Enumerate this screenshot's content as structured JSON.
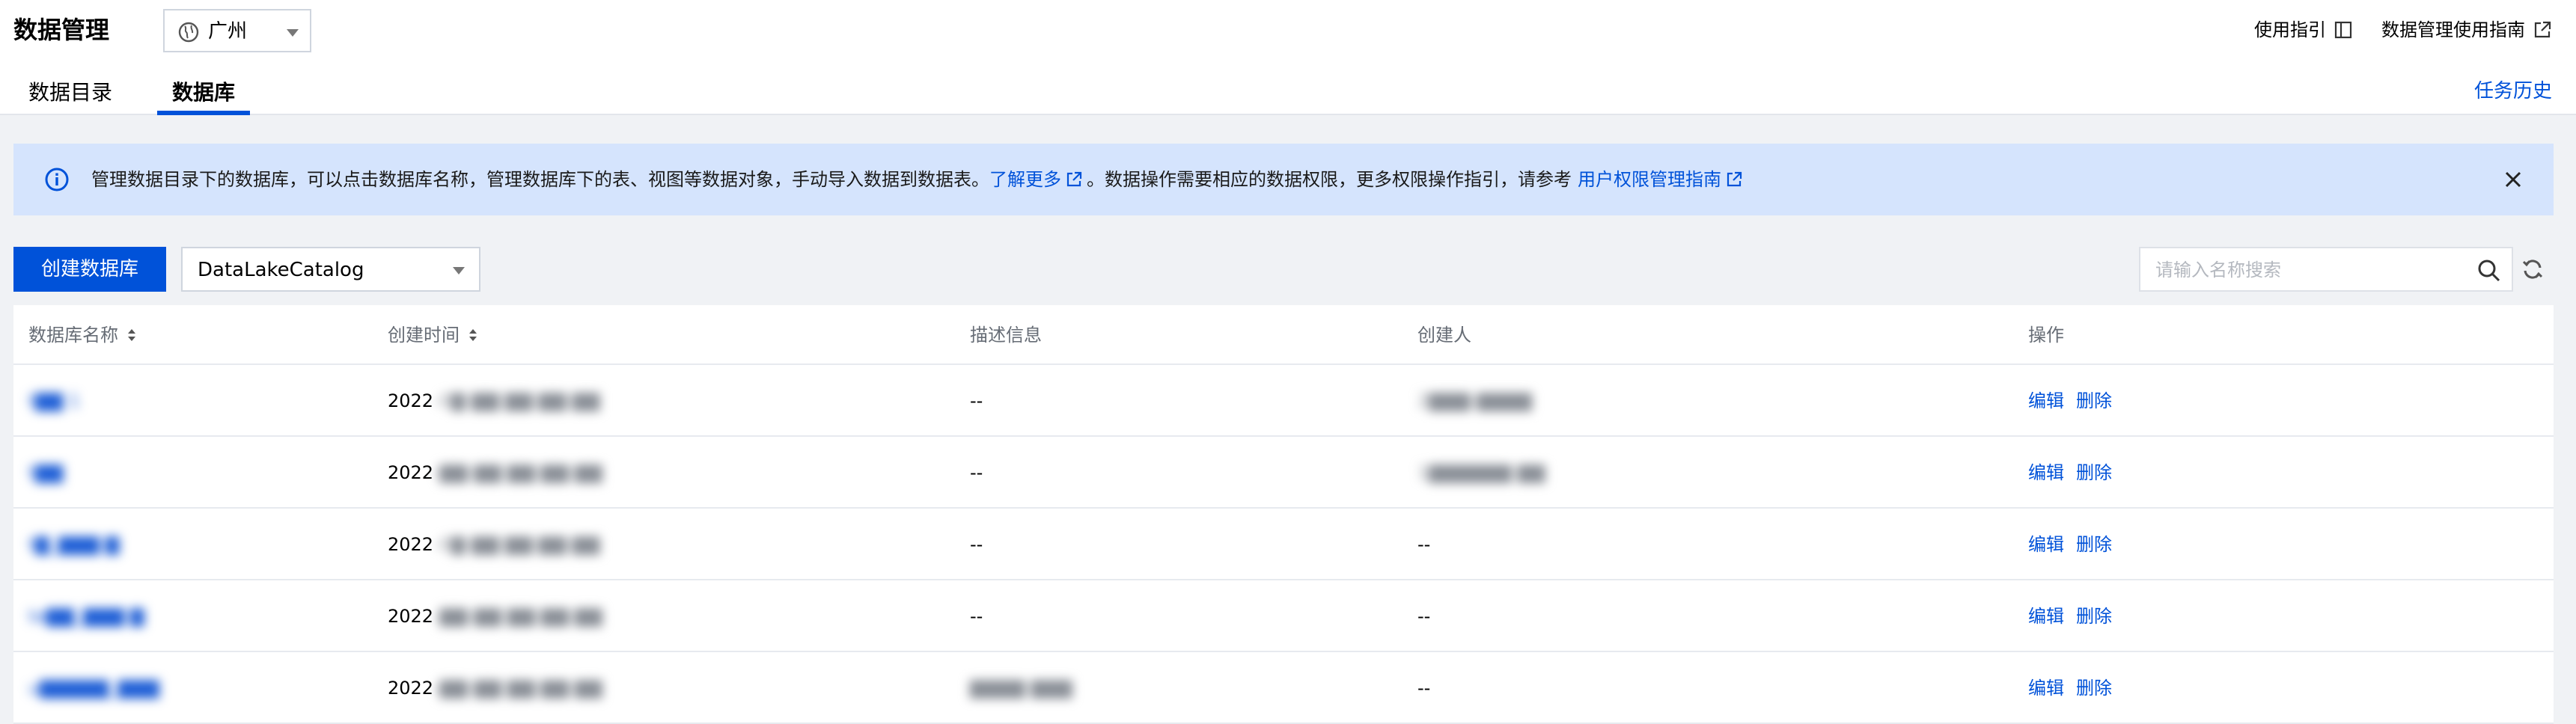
{
  "header": {
    "title": "数据管理",
    "region": "广州",
    "guide_link": "使用指引",
    "manual_link": "数据管理使用指南",
    "tabs": [
      "数据目录",
      "数据库"
    ],
    "active_tab": "数据库",
    "task_history": "任务历史"
  },
  "banner": {
    "text_part1": "管理数据目录下的数据库，可以点击数据库名称，管理数据库下的表、视图等数据对象，手动导入数据到数据表。",
    "learn_more": "了解更多",
    "text_part2": "。数据操作需要相应的数据权限，更多权限操作指引，请参考",
    "permission_link": "用户权限管理指南"
  },
  "toolbar": {
    "create_button": "创建数据库",
    "catalog_value": "DataLakeCatalog",
    "search_placeholder": "请输入名称搜索"
  },
  "table": {
    "columns": [
      "数据库名称",
      "创建时间",
      "描述信息",
      "创建人",
      "操作"
    ],
    "rows": [
      {
        "name": "t▇▇  1",
        "created": "2022",
        "created_rest": "-0▇-▇▇ ▇▇:▇▇:▇▇",
        "desc": "--",
        "creator": "2▇▇▇-▇▇▇▇",
        "actions": [
          "编辑",
          "删除"
        ]
      },
      {
        "name": "t▇▇",
        "created": "2022",
        "created_rest": "-▇▇-▇▇ ▇▇:▇▇:▇▇",
        "desc": "--",
        "creator": "1▇▇▇▇▇▇ ▇▇",
        "actions": [
          "编辑",
          "删除"
        ]
      },
      {
        "name": "t▇_▇▇▇  ▇",
        "created": "2022",
        "created_rest": "-0▇-▇▇ ▇▇:▇▇:▇▇",
        "desc": "--",
        "creator": "--",
        "actions": [
          "编辑",
          "删除"
        ]
      },
      {
        "name": "te▇▇_▇▇▇  ▇",
        "created": "2022",
        "created_rest": "-▇▇-▇▇ ▇▇:▇▇:▇▇",
        "desc": "--",
        "creator": "--",
        "actions": [
          "编辑",
          "删除"
        ]
      },
      {
        "name": "u▇▇▇▇▇_▇▇▇",
        "created": "2022",
        "created_rest": "-▇▇-▇▇ ▇▇:▇▇:▇▇",
        "desc": "▇▇▇▇  ▇▇▇",
        "creator": "--",
        "actions": [
          "编辑",
          "删除"
        ]
      }
    ]
  },
  "colors": {
    "accent": "#0052d9",
    "banner_bg": "#d5e4fd",
    "page_bg": "#f0f2f5"
  }
}
